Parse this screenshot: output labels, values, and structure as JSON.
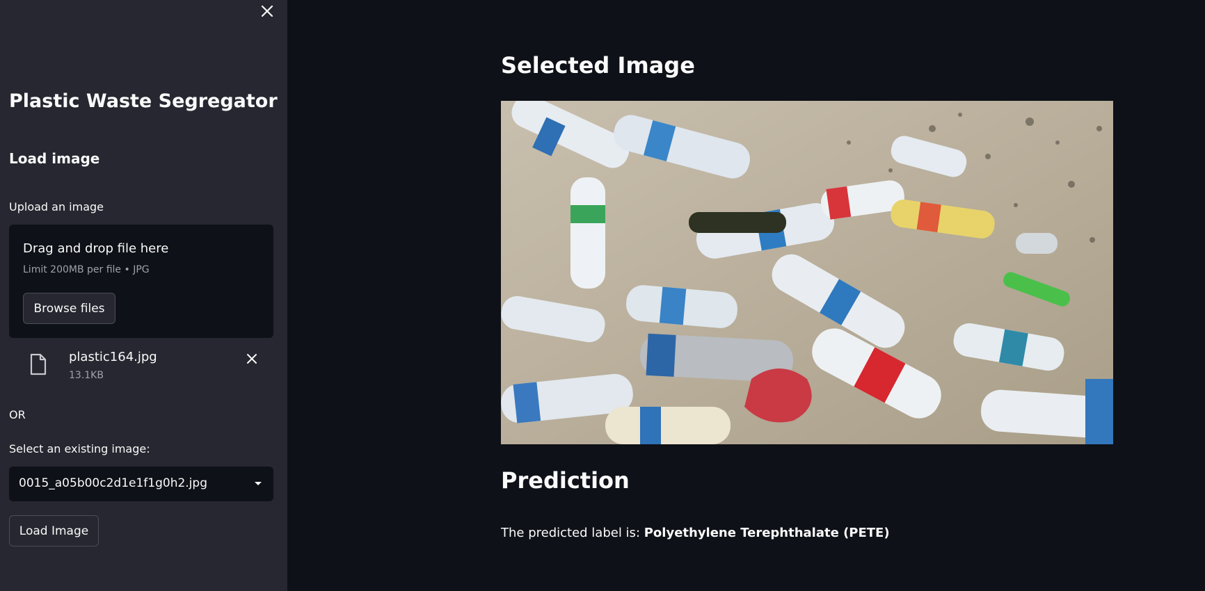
{
  "sidebar": {
    "title": "Plastic Waste Segregator",
    "section_heading": "Load image",
    "upload_label": "Upload an image",
    "dropzone": {
      "title": "Drag and drop file here",
      "limit_text": "Limit 200MB per file • JPG",
      "browse_label": "Browse files"
    },
    "uploaded_file": {
      "name": "plastic164.jpg",
      "size": "13.1KB"
    },
    "or_text": "OR",
    "select_label": "Select an existing image:",
    "select_value": "0015_a05b00c2d1e1f1g0h2.jpg",
    "load_button_label": "Load Image"
  },
  "main": {
    "selected_heading": "Selected Image",
    "prediction_heading": "Prediction",
    "prediction_prefix": "The predicted label is: ",
    "prediction_label": "Polyethylene Terephthalate (PETE)"
  },
  "colors": {
    "background": "#0e1117",
    "sidebar": "#262730",
    "text": "#fafafa",
    "muted": "#9ea2ab"
  },
  "icons": {
    "close_sidebar": "close-icon",
    "file": "file-icon",
    "remove_file": "close-icon",
    "select_caret": "chevron-down-icon"
  }
}
